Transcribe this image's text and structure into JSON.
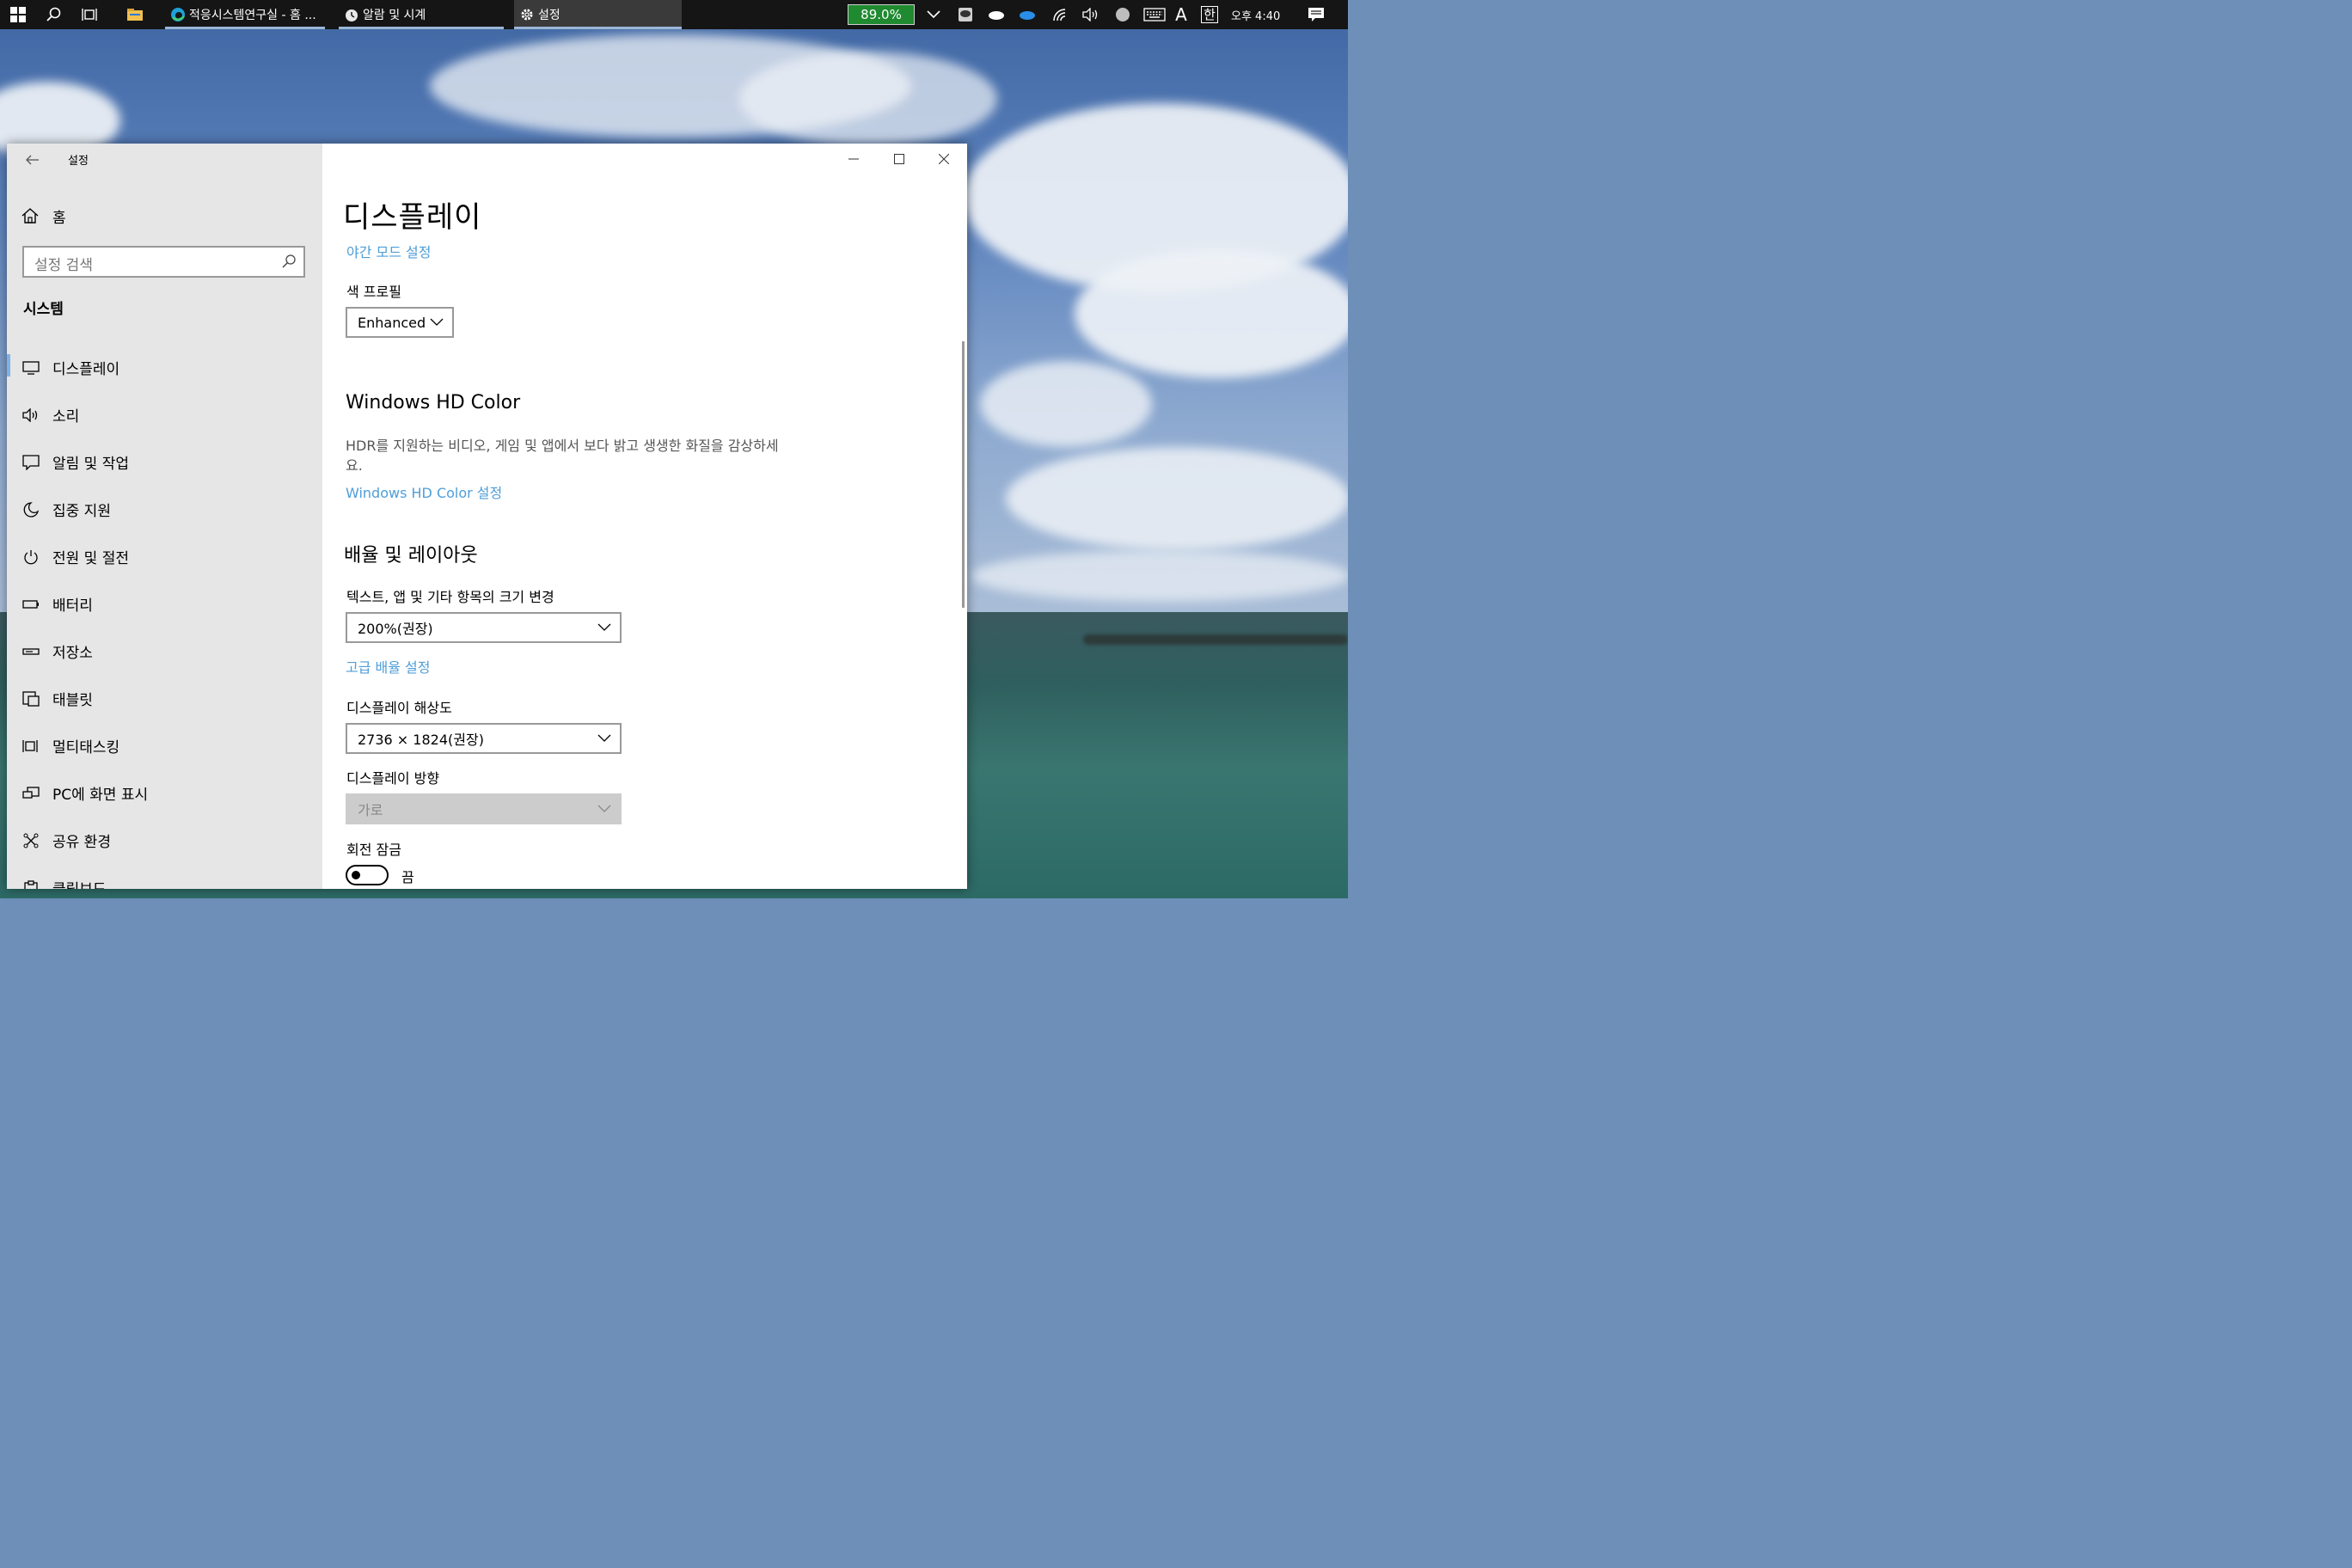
{
  "taskbar": {
    "apps": [
      {
        "label": "적응시스템연구실 - 홈 ...",
        "icon": "edge-browser-icon"
      },
      {
        "label": "알람 및 시계",
        "icon": "alarm-clock-icon"
      },
      {
        "label": "설정",
        "icon": "settings-gear-icon"
      }
    ],
    "battery": "89.0%",
    "clock": "오후 4:40",
    "ime_mode": "A",
    "ime_lang": "한"
  },
  "window": {
    "title": "설정"
  },
  "sidebar": {
    "home_label": "홈",
    "search_placeholder": "설정 검색",
    "section_title": "시스템",
    "items": [
      {
        "label": "디스플레이",
        "icon": "monitor-icon",
        "selected": true
      },
      {
        "label": "소리",
        "icon": "speaker-icon"
      },
      {
        "label": "알림 및 작업",
        "icon": "notification-icon"
      },
      {
        "label": "집중 지원",
        "icon": "moon-icon"
      },
      {
        "label": "전원 및 절전",
        "icon": "power-icon"
      },
      {
        "label": "배터리",
        "icon": "battery-icon"
      },
      {
        "label": "저장소",
        "icon": "storage-icon"
      },
      {
        "label": "태블릿",
        "icon": "tablet-icon"
      },
      {
        "label": "멀티태스킹",
        "icon": "multitasking-icon"
      },
      {
        "label": "PC에 화면 표시",
        "icon": "project-icon"
      },
      {
        "label": "공유 환경",
        "icon": "shared-experiences-icon"
      },
      {
        "label": "클립보드",
        "icon": "clipboard-icon"
      }
    ]
  },
  "main": {
    "title": "디스플레이",
    "night_mode_link": "야간 모드 설정",
    "color_profile_label": "색 프로필",
    "color_profile_value": "Enhanced",
    "hd_color_heading": "Windows HD Color",
    "hd_color_desc": "HDR를 지원하는 비디오, 게임 및 앱에서 보다 밝고 생생한 화질을 감상하세요.",
    "hd_color_link": "Windows HD Color 설정",
    "scale_heading": "배율 및 레이아웃",
    "scale_label": "텍스트, 앱 및 기타 항목의 크기 변경",
    "scale_value": "200%(권장)",
    "advanced_scale_link": "고급 배율 설정",
    "resolution_label": "디스플레이 해상도",
    "resolution_value": "2736 × 1824(권장)",
    "orientation_label": "디스플레이 방향",
    "orientation_value": "가로",
    "rotation_lock_label": "회전 잠금",
    "rotation_lock_state": "끔"
  },
  "colors": {
    "accent_link": "#4f9ed8",
    "battery_green": "#1f8a30",
    "sidebar_bg": "#e6e6e6",
    "taskbar_bg": "#151515"
  }
}
